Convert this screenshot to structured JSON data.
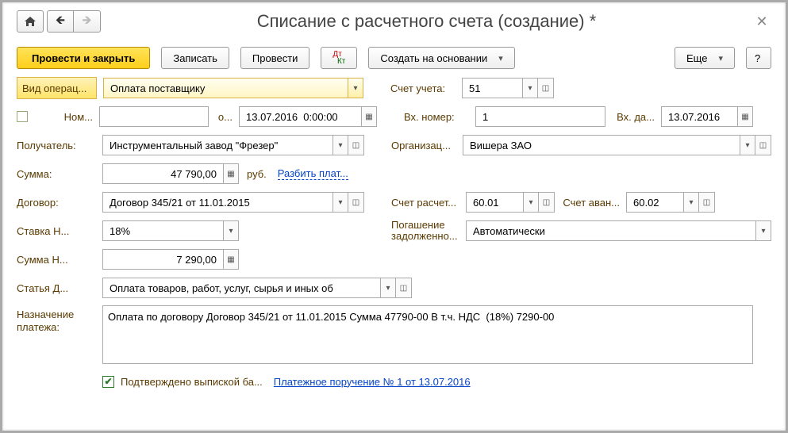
{
  "title": "Списание с расчетного счета (создание) *",
  "toolbar": {
    "post_close": "Провести и закрыть",
    "write": "Записать",
    "post": "Провести",
    "create_based": "Создать на основании",
    "more": "Еще"
  },
  "fields": {
    "op_type_label": "Вид операц...",
    "op_type_value": "Оплата поставщику",
    "acct_label": "Счет учета:",
    "acct_value": "51",
    "num_label": "Ном...",
    "num_value": "",
    "from_label": "о...",
    "date_value": "13.07.2016  0:00:00",
    "in_num_label": "Вх. номер:",
    "in_num_value": "1",
    "in_date_label": "Вх. да...",
    "in_date_value": "13.07.2016",
    "payee_label": "Получатель:",
    "payee_value": "Инструментальный завод \"Фрезер\"",
    "org_label": "Организац...",
    "org_value": "Вишера ЗАО",
    "sum_label": "Сумма:",
    "sum_value": "47 790,00",
    "currency": "руб.",
    "split_link": "Разбить плат...",
    "contract_label": "Договор:",
    "contract_value": "Договор 345/21 от 11.01.2015",
    "settle_acct_label": "Счет расчет...",
    "settle_acct_value": "60.01",
    "advance_acct_label": "Счет аван...",
    "advance_acct_value": "60.02",
    "vat_rate_label": "Ставка Н...",
    "vat_rate_value": "18%",
    "debt_label1": "Погашение",
    "debt_label2": "задолженно...",
    "debt_value": "Автоматически",
    "vat_sum_label": "Сумма Н...",
    "vat_sum_value": "7 290,00",
    "item_label": "Статья Д...",
    "item_value": "Оплата товаров, работ, услуг, сырья и иных об",
    "purpose_label1": "Назначение",
    "purpose_label2": "платежа:",
    "purpose_value": "Оплата по договору Договор 345/21 от 11.01.2015 Сумма 47790-00 В т.ч. НДС  (18%) 7290-00",
    "confirmed_label": "Подтверждено выпиской ба...",
    "pay_order_link": "Платежное поручение № 1 от 13.07.2016"
  }
}
